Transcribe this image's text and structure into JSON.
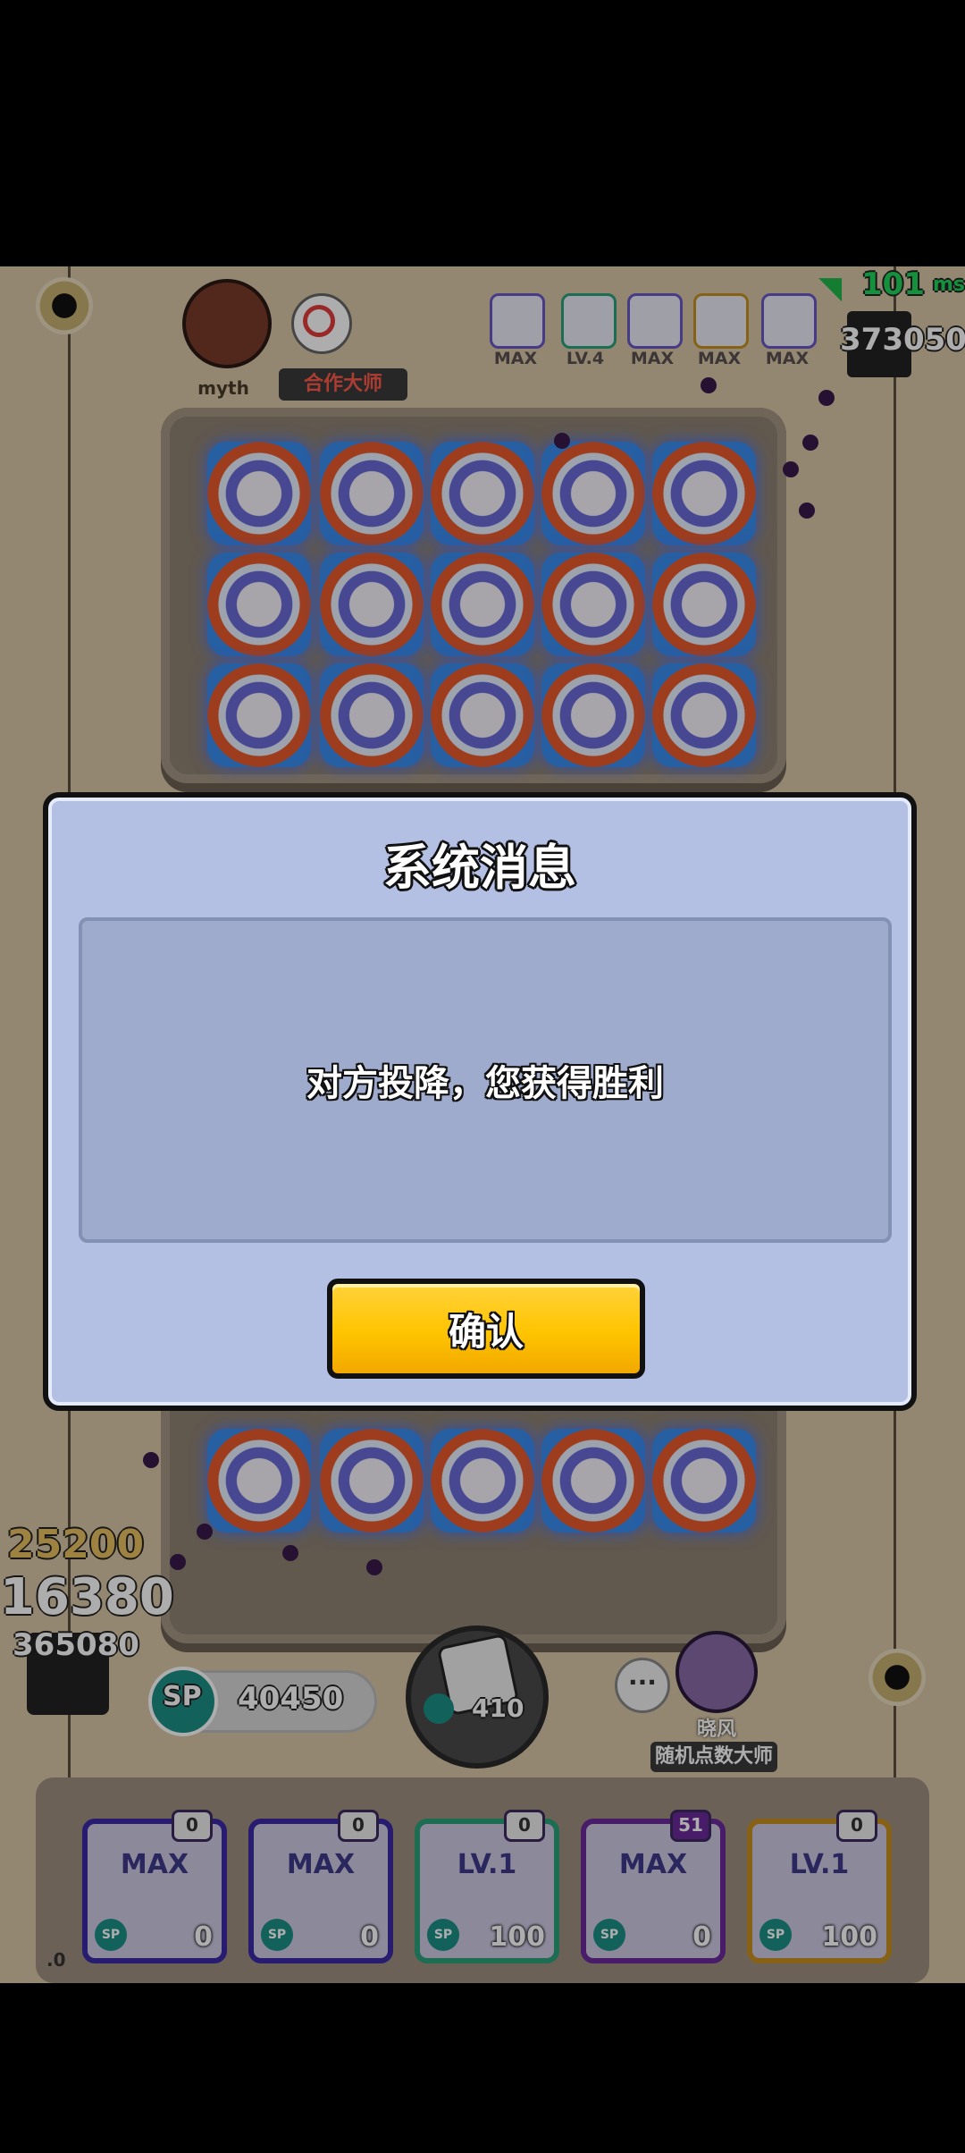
{
  "hud": {
    "ping_value": "101",
    "ping_unit": "ms",
    "opponent_score": "373050",
    "opponent_name": "myth",
    "opponent_title": "合作大师",
    "opponent_deck_levels": [
      "MAX",
      "LV.4",
      "MAX",
      "MAX",
      "MAX"
    ],
    "player_score_top": "25200",
    "player_score_main": "16380",
    "player_score_sub": "365080",
    "sp_label": "SP",
    "sp_value": "40450",
    "summon_cost": "410",
    "player_name": "晓风",
    "player_title": "随机点数大师",
    "version_fragment": ".0"
  },
  "player_deck": [
    {
      "level": "MAX",
      "count": "0",
      "cost": "0"
    },
    {
      "level": "MAX",
      "count": "0",
      "cost": "0"
    },
    {
      "level": "LV.1",
      "count": "0",
      "cost": "100"
    },
    {
      "level": "MAX",
      "count": "51",
      "cost": "0"
    },
    {
      "level": "LV.1",
      "count": "0",
      "cost": "100"
    }
  ],
  "dialog": {
    "title": "系统消息",
    "message": "对方投降，您获得胜利",
    "confirm_label": "确认"
  },
  "colors": {
    "dialog_bg": "#b4bfe4",
    "message_bg": "#9fabcd",
    "confirm_button": "#ffc400",
    "background": "#d9c7a8"
  }
}
